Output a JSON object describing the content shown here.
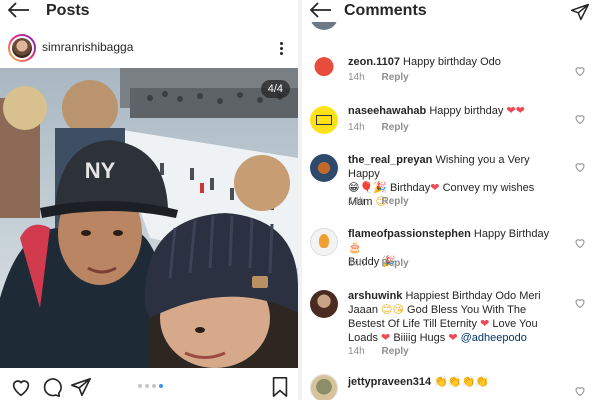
{
  "posts": {
    "title": "Posts",
    "username": "simranrishibagga",
    "image_counter": "4/4",
    "carousel_total": 4,
    "carousel_active": 4
  },
  "comments_panel": {
    "title": "Comments",
    "comments": [
      {
        "user": "zeon.1107",
        "text": "Happy birthday Odo",
        "time": "14h",
        "reply": "Reply"
      },
      {
        "user": "naseehawahab",
        "text": "Happy birthday ",
        "emoji": "❤❤",
        "time": "14h",
        "reply": "Reply"
      },
      {
        "user": "the_real_preyan",
        "text": "Wishing you a Very Happy",
        "line2": "Birthday",
        "line2b": "Convey my wishes",
        "line3": "Mam",
        "time": "14h",
        "reply": "Reply"
      },
      {
        "user": "flameofpassionstephen",
        "text": "Happy Birthday",
        "line2": "Buddy",
        "time": "14h",
        "reply": "Reply"
      },
      {
        "user": "arshuwink",
        "text": "Happiest Birthday Odo Meri",
        "line2": "Jaaan",
        "line2b": "God Bless You With The",
        "line3": "Bestest Of Life Till Eternity",
        "line3b": "Love You",
        "line4": "Loads",
        "line4b": "Biiiig Hugs",
        "mention": "@adheepodo",
        "time": "14h",
        "reply": "Reply"
      },
      {
        "user": "jettypraveen314",
        "emoji": "👏👏👏👏"
      }
    ]
  },
  "colors": {
    "accent_blue": "#3897f0",
    "heart_red": "#ed4956",
    "meta_grey": "#8e8e8e"
  }
}
